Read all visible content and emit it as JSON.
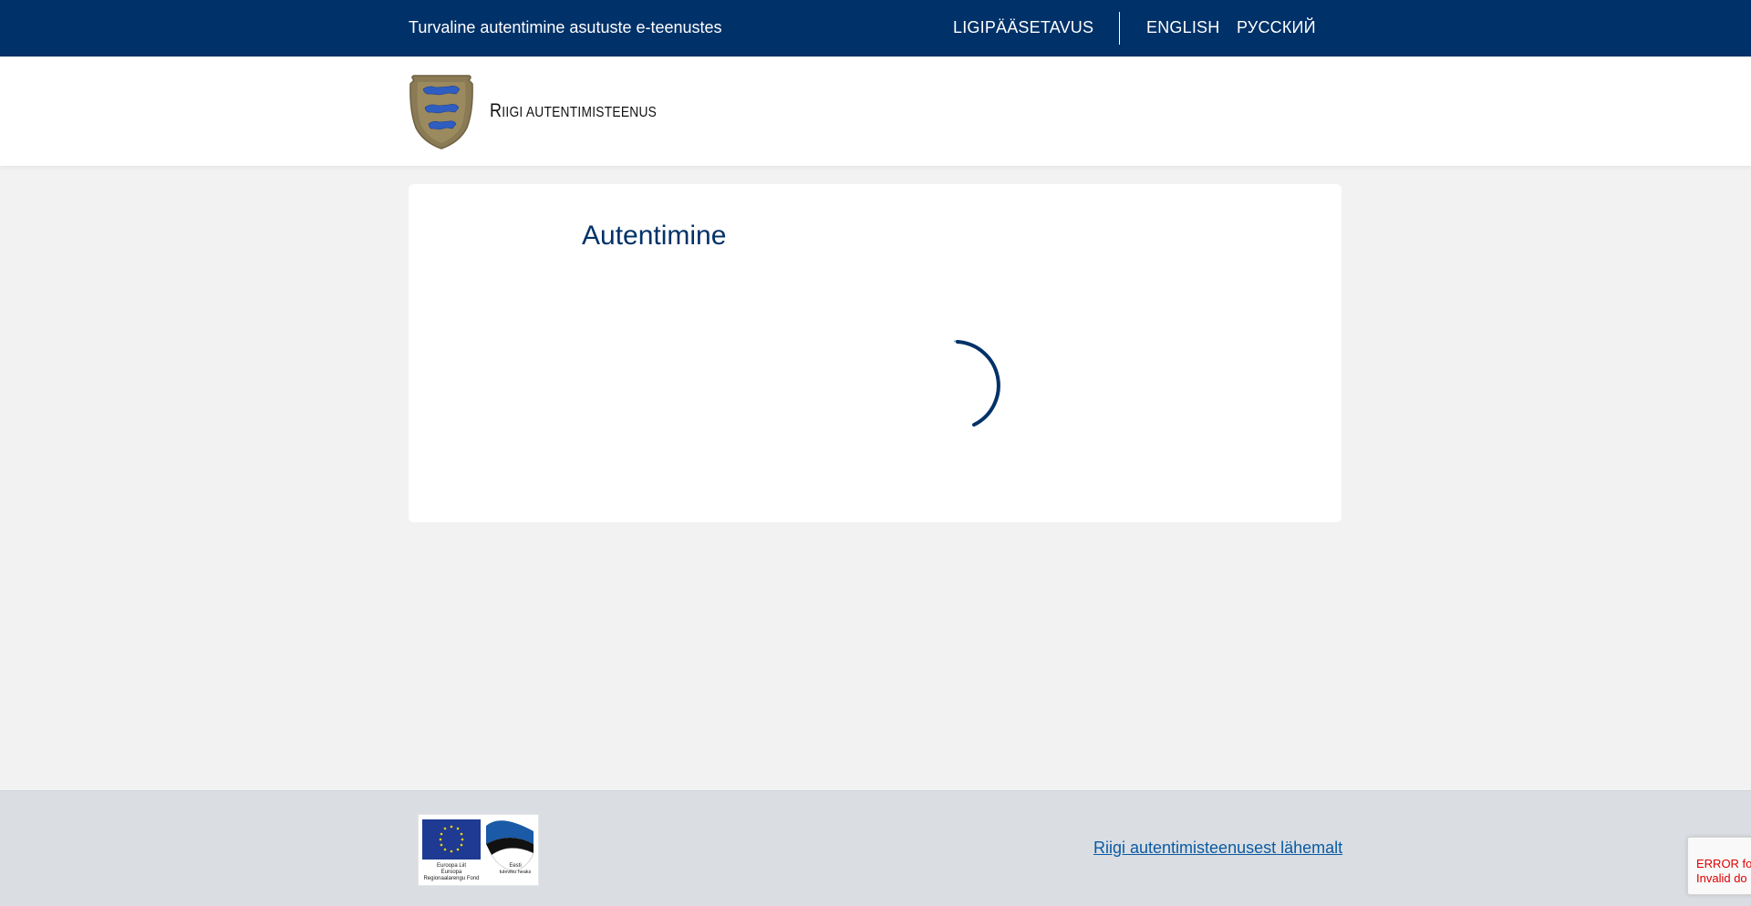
{
  "header": {
    "tagline": "Turvaline autentimine asutuste e-teenustes",
    "accessibility_link": "LIGIPÄÄSETAVUS",
    "languages": [
      "ENGLISH",
      "РУССКИЙ"
    ],
    "background_color": "#003168"
  },
  "brand": {
    "name_first_letter": "R",
    "name_rest_1": "IIGI ",
    "name_second_word": "AUTENTIMISTEENUS",
    "crest_icon": "estonia-coat-of-arms-icon"
  },
  "main": {
    "title": "Autentimine",
    "loading_state": "spinner"
  },
  "footer": {
    "logos_icon": "eu-regional-fund-estonia-logos",
    "eu_caption_lines": [
      "Euroopa Liit",
      "Euroopa",
      "Regionaalarengu Fond"
    ],
    "ee_caption_lines": [
      "Eesti",
      "tuleviku heaks"
    ],
    "about_link": "Riigi autentimisteenusest lähemalt"
  },
  "recaptcha": {
    "error_line1": "ERROR fo",
    "error_line2": "Invalid do"
  },
  "colors": {
    "accent": "#003168",
    "page_background": "#f2f2f2",
    "footer_background": "#dadee2",
    "link": "#0b5aa3"
  }
}
